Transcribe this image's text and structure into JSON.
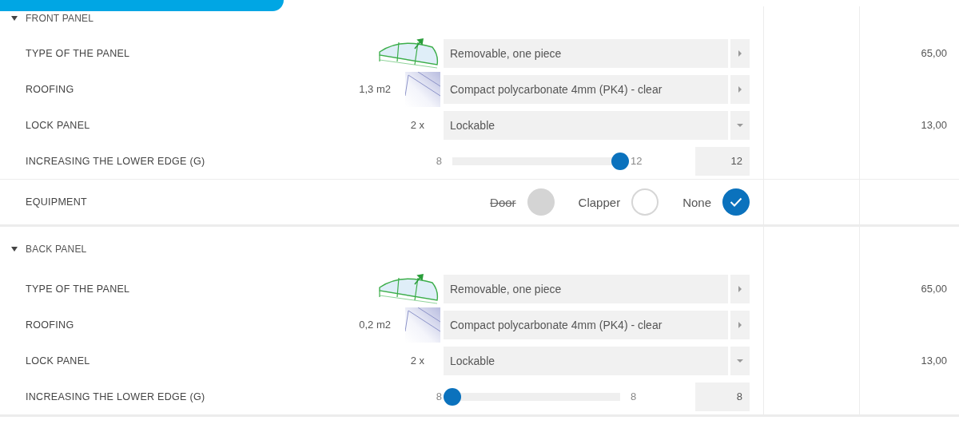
{
  "sections": [
    {
      "title": "FRONT PANEL",
      "expanded": true,
      "rows": [
        {
          "kind": "picker",
          "label": "TYPE OF THE PANEL",
          "picture": {
            "kind": "panel"
          },
          "value": "Removable, one piece",
          "price": "65,00"
        },
        {
          "kind": "picker",
          "label": "ROOFING",
          "quantity": "1,3  m2",
          "picture": {
            "kind": "roofing"
          },
          "value": "Compact polycarbonate 4mm (PK4) - clear"
        },
        {
          "kind": "dropdown",
          "label": "LOCK PANEL",
          "quantity": "2 x",
          "value": "Lockable",
          "price": "13,00"
        },
        {
          "kind": "slider",
          "label": "INCREASING THE LOWER EDGE (G)",
          "min": "8",
          "max": "12",
          "value": "12",
          "level": 1
        },
        {
          "kind": "options",
          "label": "EQUIPMENT",
          "options": [
            {
              "label": "Door",
              "disabled": true,
              "selected": false
            },
            {
              "label": "Clapper",
              "disabled": false,
              "selected": false
            },
            {
              "label": "None",
              "disabled": false,
              "selected": true
            }
          ]
        }
      ]
    },
    {
      "title": "BACK PANEL",
      "expanded": true,
      "rows": [
        {
          "kind": "picker",
          "label": "TYPE OF THE PANEL",
          "picture": {
            "kind": "panel"
          },
          "value": "Removable, one piece",
          "price": "65,00"
        },
        {
          "kind": "picker",
          "label": "ROOFING",
          "quantity": "0,2  m2",
          "picture": {
            "kind": "roofing"
          },
          "value": "Compact polycarbonate 4mm (PK4) - clear"
        },
        {
          "kind": "dropdown",
          "label": "LOCK PANEL",
          "quantity": "2 x",
          "value": "Lockable",
          "price": "13,00"
        },
        {
          "kind": "slider",
          "label": "INCREASING THE LOWER EDGE (G)",
          "min": "8",
          "max": "8",
          "value": "8",
          "level": 0
        }
      ]
    }
  ]
}
